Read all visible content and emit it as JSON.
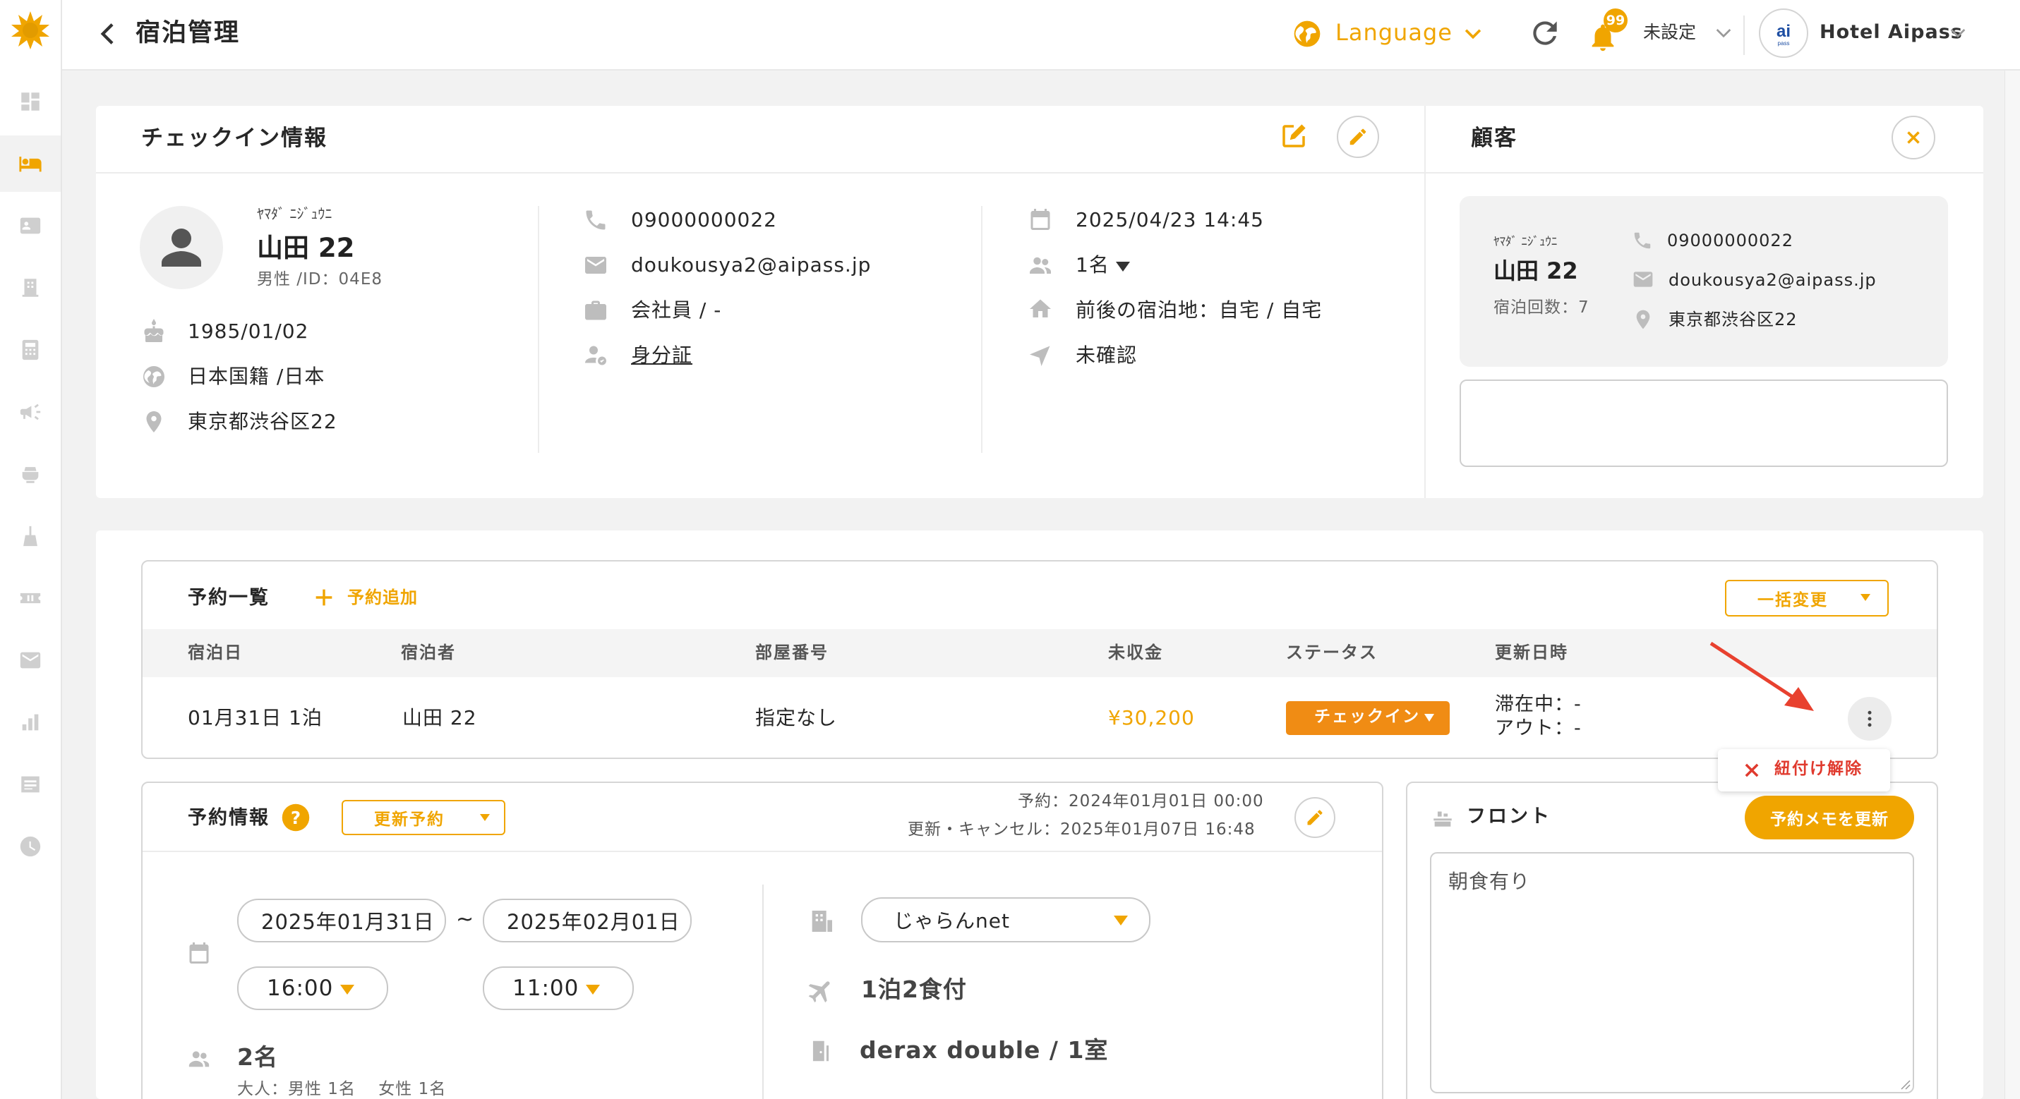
{
  "colors": {
    "accent": "#f0a500",
    "checkin_button": "#f08c14",
    "danger": "#e03a2e",
    "arrow": "#e8412f"
  },
  "header": {
    "title": "宿泊管理",
    "language_label": "Language",
    "notification_count": "99",
    "setting_label": "未設定",
    "hotel_name": "Hotel Aipass"
  },
  "sidebar": {
    "items": [
      "dashboard-icon",
      "bed-icon",
      "contacts-icon",
      "building-icon",
      "calculator-icon",
      "megaphone-icon",
      "cleaning-icon",
      "broom-icon",
      "ticket-icon",
      "mail-icon",
      "bar-chart-icon",
      "list-icon",
      "clock-icon"
    ],
    "active_index": 1
  },
  "checkin": {
    "title": "チェックイン情報",
    "kana": "ﾔﾏﾀﾞ ﾆｼﾞｭｳﾆ",
    "name": "山田 22",
    "gender_id": "男性 /ID：04E8",
    "birthday": "1985/01/02",
    "nationality": "日本国籍 /日本",
    "address": "東京都渋谷区22",
    "phone": "09000000022",
    "email": "doukousya2@aipass.jp",
    "occupation": "会社員 / -",
    "id_card": "身分証",
    "checkin_datetime": "2025/04/23 14:45",
    "guests": "1名",
    "prev_next_stay": "前後の宿泊地：自宅 / 自宅",
    "confirmation": "未確認"
  },
  "customer": {
    "title": "顧客",
    "kana": "ﾔﾏﾀﾞ ﾆｼﾞｭｳﾆ",
    "name": "山田 22",
    "stay_count": "宿泊回数：7",
    "phone": "09000000022",
    "email": "doukousya2@aipass.jp",
    "address": "東京都渋谷区22",
    "memo": ""
  },
  "reservations": {
    "title": "予約一覧",
    "add_label": "予約追加",
    "bulk_change_label": "一括変更",
    "columns": [
      "宿泊日",
      "宿泊者",
      "部屋番号",
      "未収金",
      "ステータス",
      "更新日時"
    ],
    "rows": [
      {
        "date": "01月31日 1泊",
        "guest": "山田 22",
        "room": "指定なし",
        "unpaid": "¥30,200",
        "status": "チェックイン",
        "updated_line1": "滞在中：-",
        "updated_line2": "アウト：-"
      }
    ],
    "context_menu": {
      "unlink_label": "紐付け解除"
    }
  },
  "reservation_info": {
    "title": "予約情報",
    "update_dropdown": "更新予約",
    "reserved_at": "予約：2024年01月01日 00:00",
    "updated_at": "更新・キャンセル：2025年01月07日 16:48",
    "checkin_date": "2025年01月31日",
    "date_separator": "~",
    "checkout_date": "2025年02月01日",
    "checkin_time": "16:00",
    "checkout_time": "11:00",
    "guests": "2名",
    "guest_breakdown": "大人：男性 1名 　女性 1名",
    "channel": "じゃらんnet",
    "plan": "1泊2食付",
    "room_type": "derax double / 1室"
  },
  "front": {
    "title": "フロント",
    "update_memo_button": "予約メモを更新",
    "memo": "朝食有り"
  }
}
